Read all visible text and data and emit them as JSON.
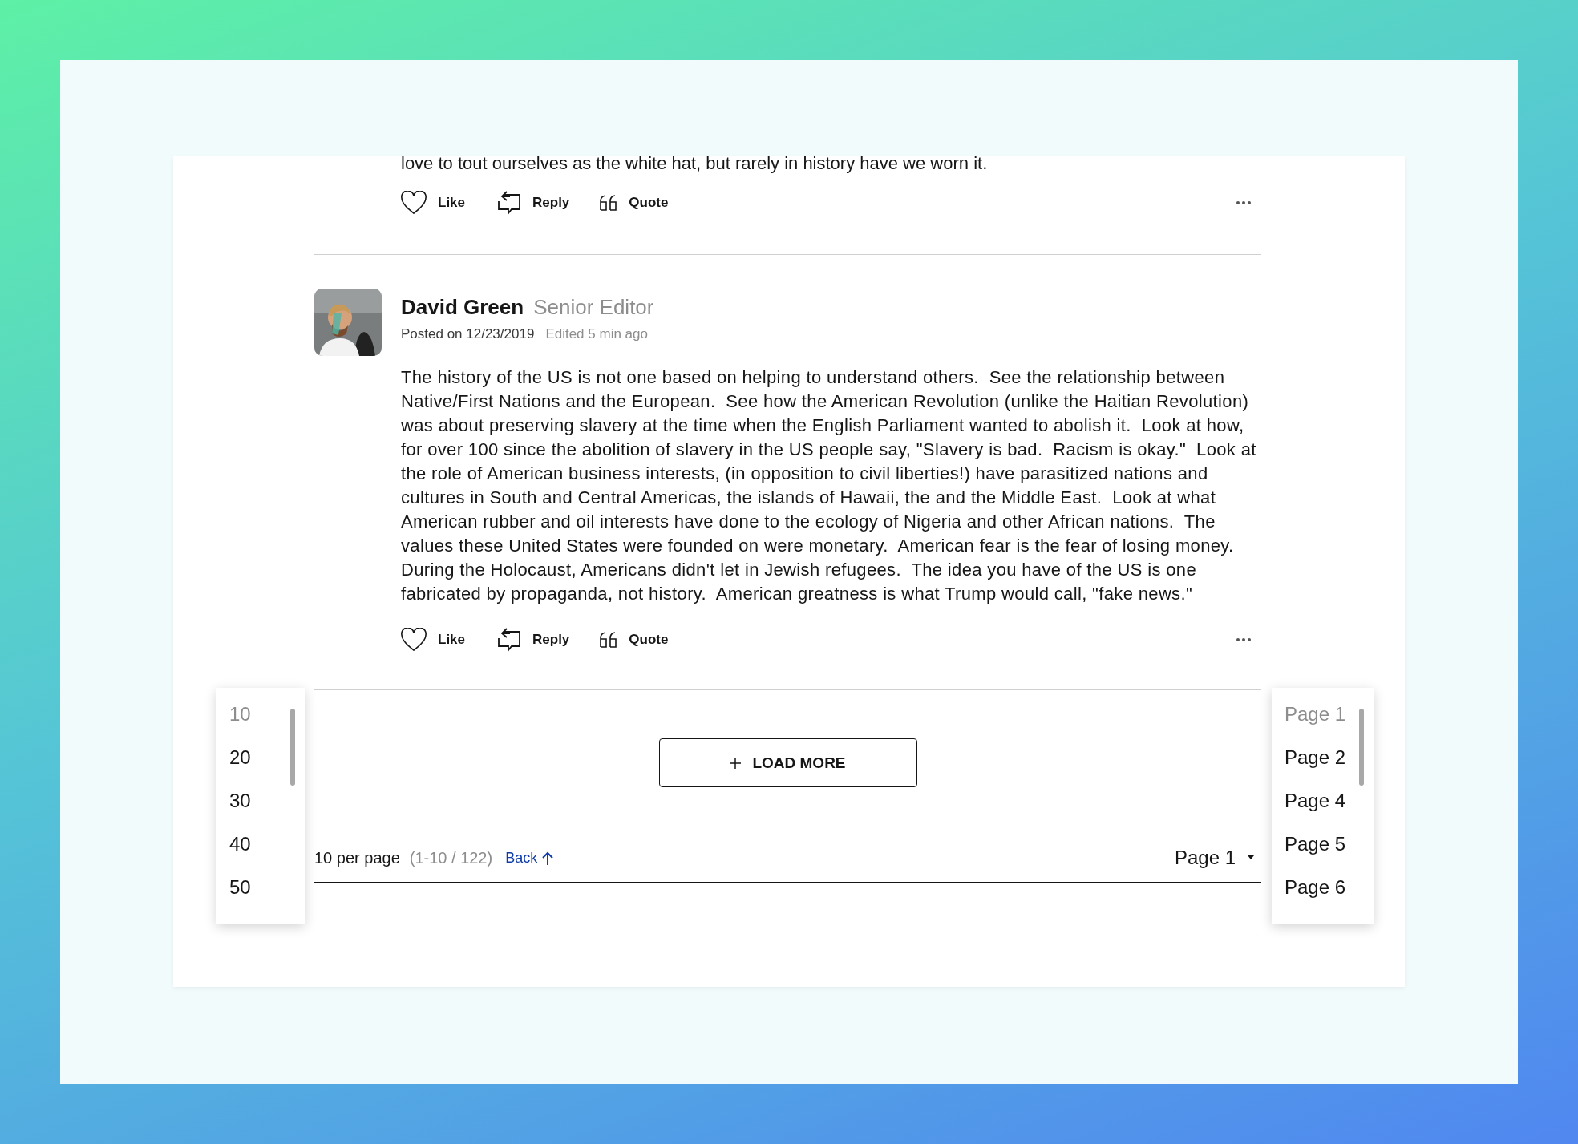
{
  "previous_post": {
    "body": "love to tout ourselves as the white hat, but rarely in history have we worn it.",
    "actions": [
      {
        "kind": "like",
        "label": "Like"
      },
      {
        "kind": "reply",
        "label": "Reply"
      },
      {
        "kind": "quote",
        "label": "Quote"
      }
    ]
  },
  "post": {
    "author": "David Green",
    "role": "Senior Editor",
    "posted": "Posted on 12/23/2019",
    "edited": "Edited 5 min ago",
    "body": "The history of the US is not one based on helping to understand others.  See the relationship between Native/First Nations and the European.  See how the American Revolution (unlike the Haitian Revolution) was about preserving slavery at the time when the English Parliament wanted to abolish it.  Look at how, for over 100 since the abolition of slavery in the US people say, \"Slavery is bad.  Racism is okay.\"  Look at the role of American business interests, (in opposition to civil liberties!) have parasitized nations and cultures in South and Central Americas, the islands of Hawaii, the and the Middle East.  Look at what American rubber and oil interests have done to the ecology of Nigeria and other African nations.  The values these United States were founded on were monetary.  American fear is the fear of losing money.  During the Holocaust, Americans didn't let in Jewish refugees.  The idea you have of the US is one fabricated by propaganda, not history.  American greatness is what Trump would call, \"fake news.\"",
    "actions": [
      {
        "kind": "like",
        "label": "Like"
      },
      {
        "kind": "reply",
        "label": "Reply"
      },
      {
        "kind": "quote",
        "label": "Quote"
      }
    ]
  },
  "load_more": {
    "label": "LOAD MORE"
  },
  "pagination": {
    "per_page": "10 per page",
    "range": "(1-10 / 122)",
    "back": "Back",
    "page": "Page 1"
  },
  "per_page_menu": {
    "items": [
      {
        "label": "10",
        "selected": true
      },
      {
        "label": "20",
        "selected": false
      },
      {
        "label": "30",
        "selected": false
      },
      {
        "label": "40",
        "selected": false
      },
      {
        "label": "50",
        "selected": false
      }
    ]
  },
  "page_menu": {
    "items": [
      {
        "label": "Page 1",
        "selected": true
      },
      {
        "label": "Page 2",
        "selected": false
      },
      {
        "label": "Page 4",
        "selected": false
      },
      {
        "label": "Page 5",
        "selected": false
      },
      {
        "label": "Page 6",
        "selected": false
      }
    ]
  }
}
